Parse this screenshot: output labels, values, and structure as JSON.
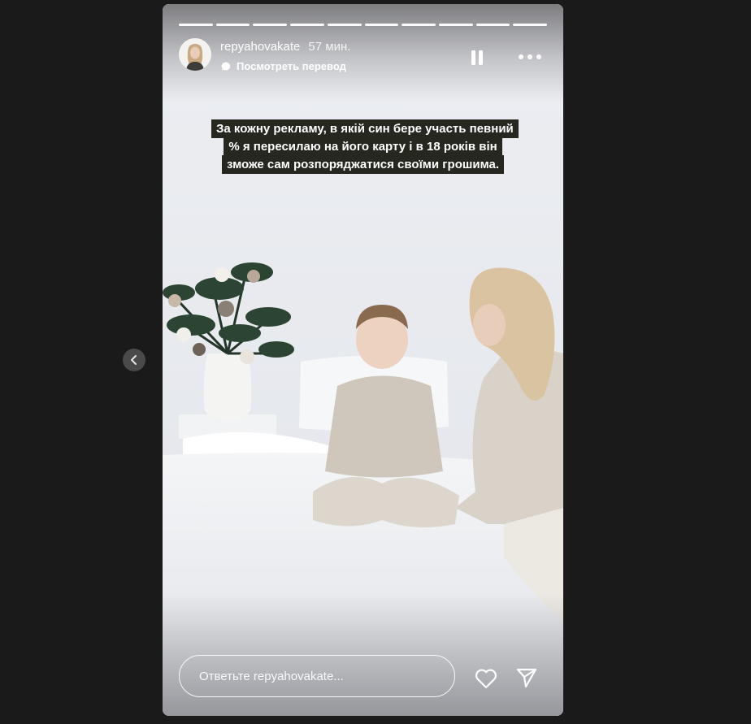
{
  "story": {
    "progress_segments": 10,
    "username": "repyahovakate",
    "time_ago": "57 мин.",
    "translate_label": "Посмотреть перевод",
    "caption": "За кожну рекламу, в якій син бере участь певний % я пересилаю на його карту і в 18 років він зможе сам розпоряджатися своїми грошима.",
    "reply_placeholder": "Ответьте repyahovakate..."
  },
  "icons": {
    "previous": "chevron-left-icon",
    "translate": "speech-bubble-icon",
    "pause": "pause-icon",
    "more": "more-horizontal-icon",
    "like": "heart-icon",
    "share": "paper-plane-icon"
  },
  "colors": {
    "page_background": "#1a1a1a",
    "caption_background": "#26271f",
    "text": "#ffffff"
  }
}
